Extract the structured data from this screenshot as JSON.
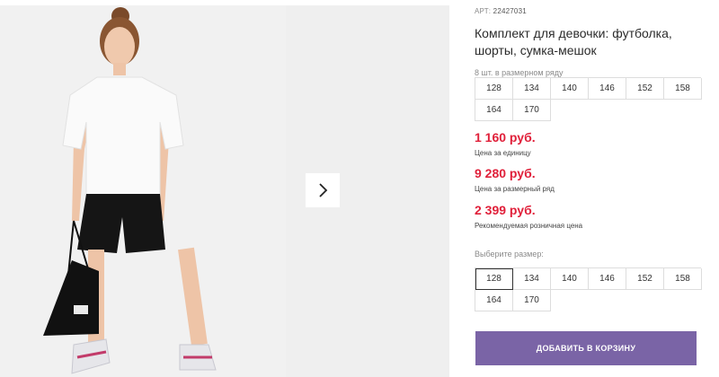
{
  "product": {
    "article_label": "АРТ:",
    "article_number": "22427031",
    "title": "Комплект для девочки: футболка, шорты, сумка-мешок"
  },
  "size_row": {
    "label": "8 шт. в размерном ряду",
    "sizes": [
      "128",
      "134",
      "140",
      "146",
      "152",
      "158",
      "164",
      "170"
    ]
  },
  "prices": [
    {
      "value": "1 160 руб.",
      "caption": "Цена за единицу"
    },
    {
      "value": "9 280 руб.",
      "caption": "Цена за размерный ряд"
    },
    {
      "value": "2 399 руб.",
      "caption": "Рекомендуемая розничная цена"
    }
  ],
  "size_select": {
    "label": "Выберите размер:",
    "sizes": [
      "128",
      "134",
      "140",
      "146",
      "152",
      "158",
      "164",
      "170"
    ],
    "selected": "128"
  },
  "cart_button": {
    "label": "ДОБАВИТЬ В КОРЗИНУ"
  },
  "gallery": {
    "next_icon": "chevron-right-icon"
  },
  "colors": {
    "price": "#e0203a",
    "button": "#7a64a6",
    "border": "#dddddd"
  }
}
